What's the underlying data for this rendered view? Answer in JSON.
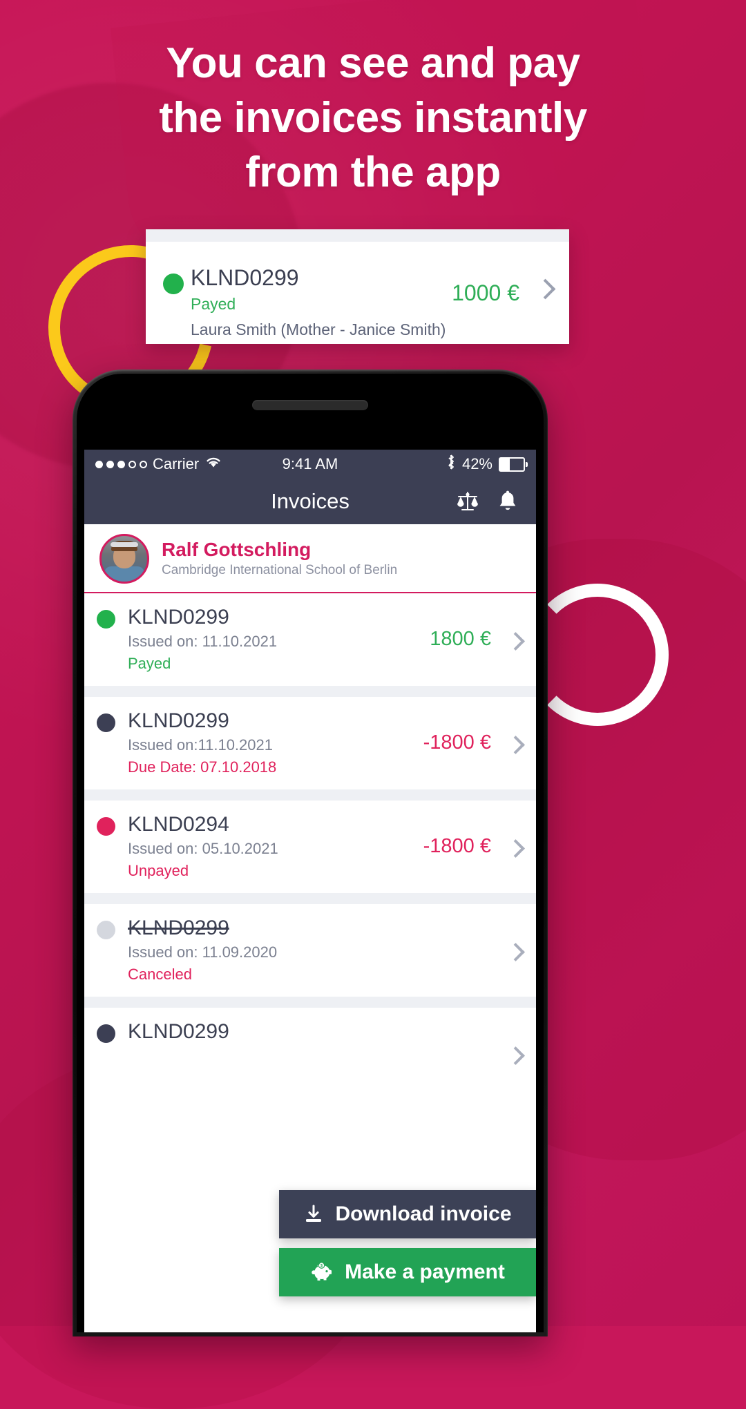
{
  "promo": {
    "headline_lines": [
      "You can see and pay",
      "the invoices instantly",
      "from the app"
    ]
  },
  "floating_card": {
    "invoice_id": "KLND0299",
    "status": "Payed",
    "payer": "Laura Smith (Mother - Janice Smith)",
    "amount": "1000 €",
    "status_color": "#2fae57",
    "dot_color": "#22b14c",
    "chevron_icon": "chevron-right-icon"
  },
  "phone": {
    "status_bar": {
      "carrier": "Carrier",
      "signal_icon": "signal-dots-icon",
      "wifi_icon": "wifi-icon",
      "time": "9:41 AM",
      "bluetooth_icon": "bluetooth-icon",
      "battery_percent": "42%",
      "battery_icon": "battery-icon",
      "battery_level": 42
    },
    "app_header": {
      "title": "Invoices",
      "icons": [
        "scales-of-justice-icon",
        "bell-icon"
      ]
    },
    "profile": {
      "name": "Ralf Gottschling",
      "school": "Cambridge International School of Berlin",
      "avatar_icon": "avatar"
    },
    "invoices": [
      {
        "id": "KLND0299",
        "issued": "Issued on: 11.10.2021",
        "status": "Payed",
        "status_color": "#2fae57",
        "amount": "1800 €",
        "amount_color": "#2fae57",
        "dot_color": "#22b14c",
        "strikethrough": false
      },
      {
        "id": "KLND0299",
        "issued": "Issued on:11.10.2021",
        "status": "Due Date: 07.10.2018",
        "status_color": "#e0225c",
        "amount": "-1800 €",
        "amount_color": "#e0225c",
        "dot_color": "#3c3f54",
        "strikethrough": false
      },
      {
        "id": "KLND0294",
        "issued": "Issued on: 05.10.2021",
        "status": "Unpayed",
        "status_color": "#e0225c",
        "amount": "-1800 €",
        "amount_color": "#e0225c",
        "dot_color": "#e0225c",
        "strikethrough": false
      },
      {
        "id": "KLND0299",
        "issued": "Issued on: 11.09.2020",
        "status": "Canceled",
        "status_color": "#e0225c",
        "amount": "",
        "amount_color": "#b9bdc9",
        "dot_color": "#d4d7de",
        "strikethrough": true
      },
      {
        "id": "KLND0299",
        "issued": "",
        "status": "",
        "status_color": "#e0225c",
        "amount": "",
        "amount_color": "#e0225c",
        "dot_color": "#3c3f54",
        "strikethrough": false
      }
    ],
    "actions": {
      "download_label": "Download invoice",
      "download_icon": "download-icon",
      "download_color": "#3c4156",
      "pay_label": "Make a payment",
      "pay_icon": "piggy-bank-icon",
      "pay_color": "#22a355"
    }
  },
  "colors": {
    "brand_pink": "#c8175a",
    "accent_yellow": "#fbc91b",
    "green": "#22b14c",
    "dark_navy": "#3c3f54"
  }
}
